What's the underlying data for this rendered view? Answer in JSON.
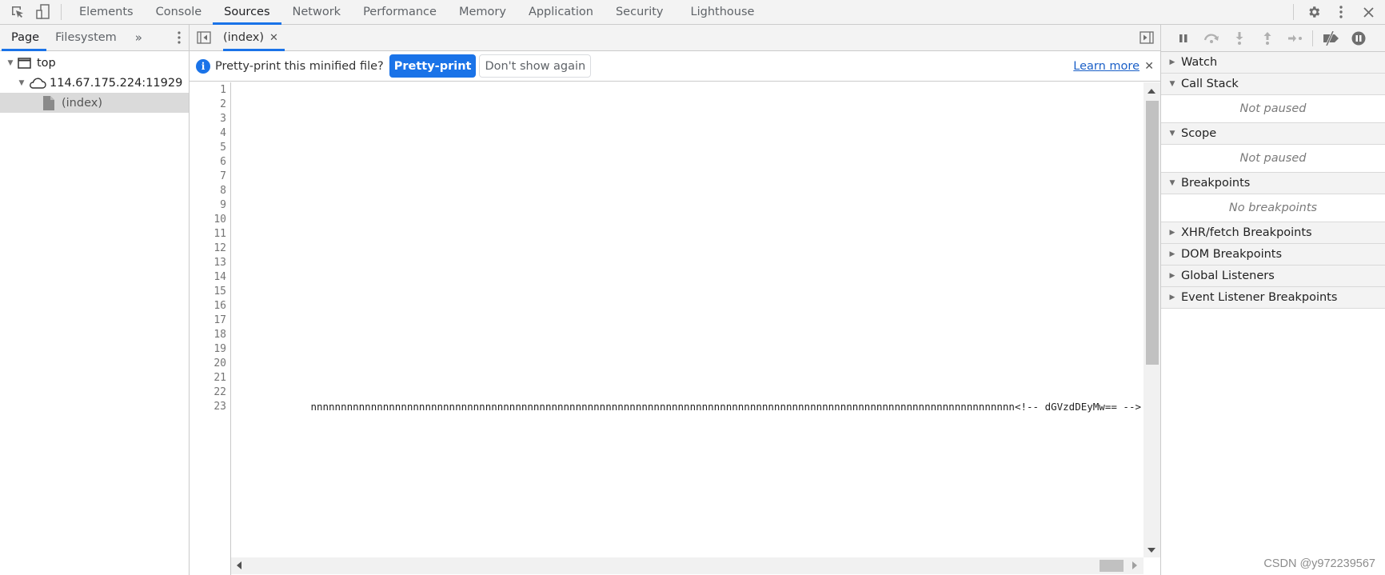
{
  "toolbar": {
    "inspect_icon": "inspect-element-icon",
    "device_icon": "device-toolbar-icon",
    "tabs": [
      {
        "label": "Elements",
        "active": false
      },
      {
        "label": "Console",
        "active": false
      },
      {
        "label": "Sources",
        "active": true
      },
      {
        "label": "Network",
        "active": false
      },
      {
        "label": "Performance",
        "active": false
      },
      {
        "label": "Memory",
        "active": false
      },
      {
        "label": "Application",
        "active": false
      },
      {
        "label": "Security",
        "active": false
      },
      {
        "label": "Lighthouse",
        "active": false
      }
    ],
    "right_icons": [
      "settings-icon",
      "more-options-icon",
      "close-icon"
    ]
  },
  "navigator": {
    "tabs": [
      {
        "label": "Page",
        "active": true
      },
      {
        "label": "Filesystem",
        "active": false
      }
    ],
    "more_label": "»",
    "tree": [
      {
        "label": "top",
        "icon": "frame-icon",
        "expanded": true,
        "level": 0
      },
      {
        "label": "114.67.175.224:11929",
        "icon": "cloud-icon",
        "expanded": true,
        "level": 1
      },
      {
        "label": "(index)",
        "icon": "file-icon",
        "selected": true,
        "level": 2
      }
    ]
  },
  "editor": {
    "open_file": "(index)",
    "infobar": {
      "message": "Pretty-print this minified file?",
      "primary_button": "Pretty-print",
      "secondary_button": "Don't show again",
      "link": "Learn more"
    },
    "line_numbers": [
      "1",
      "2",
      "3",
      "4",
      "5",
      "6",
      "7",
      "8",
      "9",
      "10",
      "11",
      "12",
      "13",
      "14",
      "15",
      "16",
      "17",
      "18",
      "19",
      "20",
      "21",
      "22",
      "23"
    ],
    "line_23_visible_text": "nnnnnnnnnnnnnnnnnnnnnnnnnnnnnnnnnnnnnnnnnnnnnnnnnnnnnnnnnnnnnnnnnnnnnnnnnnnnnnnnnnnnnnnnnnnnnnnnnnnnnnnnnnnnnnnnnnnnn<!-- dGVzdDEyMw== -->"
  },
  "debugger": {
    "controls": [
      "pause-icon",
      "step-over-icon",
      "step-into-icon",
      "step-out-icon",
      "step-icon",
      "deactivate-breakpoints-icon",
      "pause-on-exceptions-icon"
    ],
    "sections": [
      {
        "title": "Watch",
        "expanded": false
      },
      {
        "title": "Call Stack",
        "expanded": true,
        "body": "Not paused"
      },
      {
        "title": "Scope",
        "expanded": true,
        "body": "Not paused"
      },
      {
        "title": "Breakpoints",
        "expanded": true,
        "body": "No breakpoints"
      },
      {
        "title": "XHR/fetch Breakpoints",
        "expanded": false
      },
      {
        "title": "DOM Breakpoints",
        "expanded": false
      },
      {
        "title": "Global Listeners",
        "expanded": false
      },
      {
        "title": "Event Listener Breakpoints",
        "expanded": false
      }
    ]
  },
  "watermark": "CSDN @y972239567",
  "colors": {
    "accent": "#1a73e8",
    "link": "#1a5fc7"
  }
}
